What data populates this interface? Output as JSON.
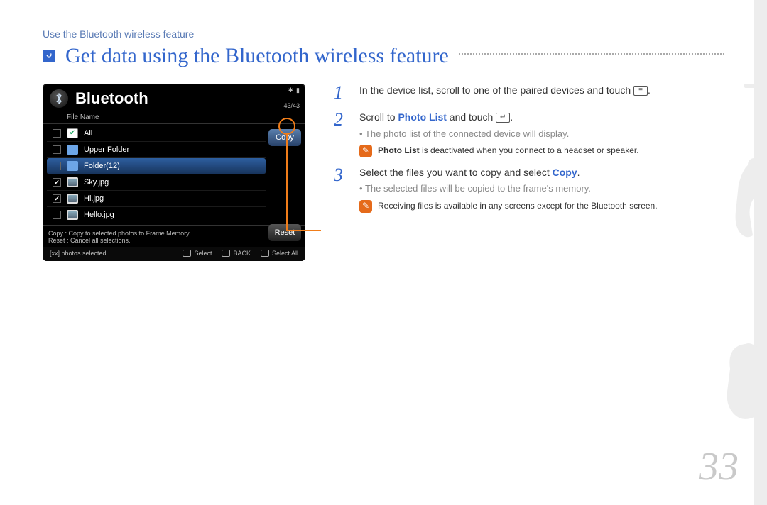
{
  "breadcrumb": "Use the Bluetooth wireless feature",
  "title": "Get data using the Bluetooth wireless feature",
  "page_number": "33",
  "screenshot": {
    "title": "Bluetooth",
    "pager": "43/43",
    "column_header": "File Name",
    "copy_btn": "Copy",
    "reset_btn": "Reset",
    "rows": [
      {
        "checked": false,
        "icon": "check",
        "label": "All"
      },
      {
        "checked": false,
        "icon": "folder",
        "label": "Upper Folder"
      },
      {
        "checked": false,
        "icon": "folder",
        "label": "Folder(12)",
        "selected": true
      },
      {
        "checked": true,
        "icon": "image",
        "label": "Sky.jpg"
      },
      {
        "checked": true,
        "icon": "image",
        "label": "Hi.jpg"
      },
      {
        "checked": false,
        "icon": "image",
        "label": "Hello.jpg"
      }
    ],
    "footer_copy": "Copy : Copy to selected photos to Frame Memory.",
    "footer_reset": "Reset : Cancel all selections.",
    "status_selected": "[xx] photos selected.",
    "tool_select": "Select",
    "tool_back": "BACK",
    "tool_selectall": "Select All"
  },
  "steps": [
    {
      "num": "1",
      "text_pre": "In the device list, scroll to one of the paired devices and touch ",
      "text_post": "."
    },
    {
      "num": "2",
      "text_pre": "Scroll to ",
      "highlight": "Photo List",
      "text_mid": " and touch ",
      "text_post": ".",
      "sub": "The photo list of the connected device will display.",
      "note_pre": "Photo List",
      "note_rest": " is deactivated when you connect to a headset or speaker."
    },
    {
      "num": "3",
      "text_pre": "Select the files you want to copy and select ",
      "highlight": "Copy",
      "text_post": ".",
      "sub": "The selected files will be copied to the frame's memory.",
      "note_rest": "Receiving files is available in any screens except for the Bluetooth screen."
    }
  ]
}
